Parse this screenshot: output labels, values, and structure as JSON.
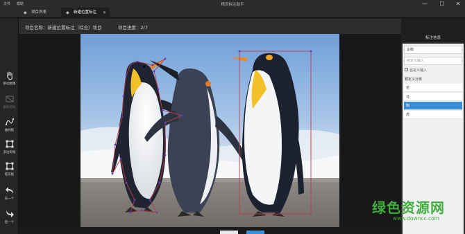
{
  "titlebar": {
    "menu": [
      "文件",
      "帮助"
    ],
    "title": "精灵标注助手",
    "buttons": [
      "—",
      "☐",
      "✕"
    ]
  },
  "tabs": [
    {
      "label": "项目列表",
      "active": false
    },
    {
      "label": "新建位置标注",
      "active": true
    }
  ],
  "infobar": {
    "project_name": "项目名称：新建位置标注（综合）项目",
    "progress": "项目进度：2/7"
  },
  "tools": [
    {
      "label": "移动图像",
      "icon": "hand-icon",
      "disabled": false
    },
    {
      "label": "删除选框",
      "icon": "delete-box-icon",
      "disabled": true
    },
    {
      "label": "曲线框",
      "icon": "curve-icon",
      "disabled": false
    },
    {
      "label": "多边形框",
      "icon": "polygon-icon",
      "disabled": false
    },
    {
      "label": "矩形框",
      "icon": "rectangle-icon",
      "disabled": false
    },
    {
      "label": "前一个",
      "icon": "prev-arrow-icon",
      "disabled": false
    },
    {
      "label": "后一个",
      "icon": "next-arrow-icon",
      "disabled": false
    }
  ],
  "panel": {
    "title": "标注信息",
    "label_value": "企鹅",
    "custom_placeholder": "自定义输入",
    "custom_checkbox": "自定义输入",
    "preset_title": "预定义分类",
    "options": [
      "花",
      "马",
      "狗",
      "虎"
    ],
    "selected_index": 2
  },
  "watermark": {
    "main": "绿色资源网",
    "url": "www.downcc.com"
  },
  "colors": {
    "accent": "#3b8fd6",
    "annotation": "#c0394b",
    "watermark": "#3fae3f"
  }
}
